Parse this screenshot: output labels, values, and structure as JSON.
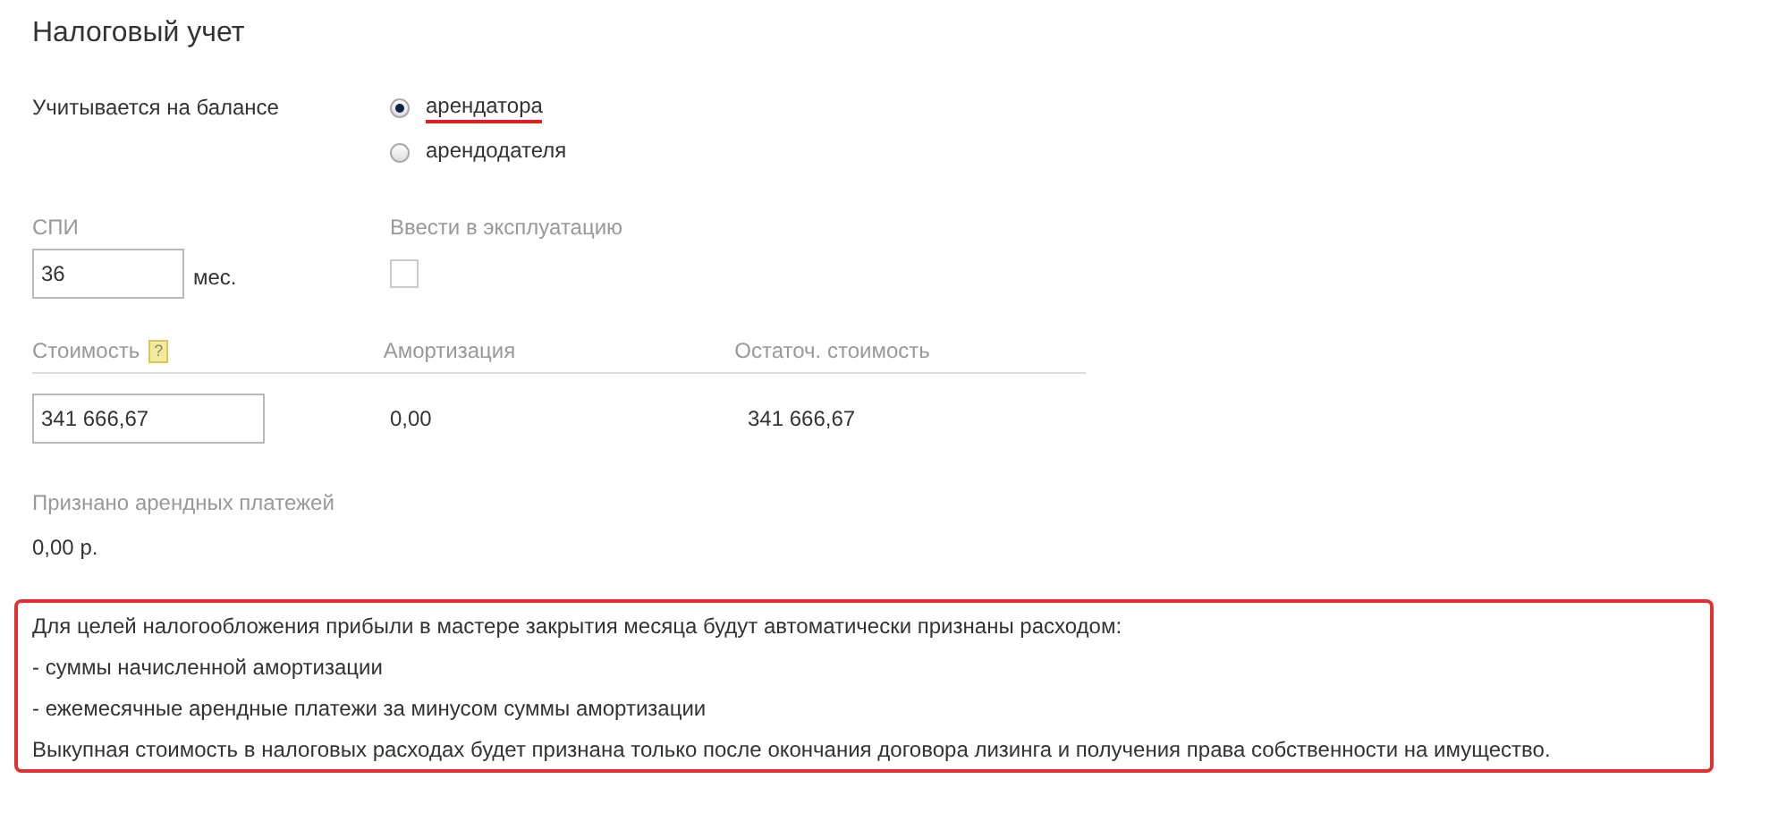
{
  "title": "Налоговый учет",
  "balance": {
    "label": "Учитывается на балансе",
    "options": [
      {
        "label": "арендатора",
        "selected": true,
        "underlined": true
      },
      {
        "label": "арендодателя",
        "selected": false,
        "underlined": false
      }
    ]
  },
  "spi": {
    "label": "СПИ",
    "value": "36",
    "unit": "мес."
  },
  "commission": {
    "label": "Ввести в эксплуатацию",
    "checked": false
  },
  "cost": {
    "columns": [
      {
        "label": "Стоимость",
        "help": "?"
      },
      {
        "label": "Амортизация"
      },
      {
        "label": "Остаточ. стоимость"
      }
    ],
    "input_value": "341 666,67",
    "amortization": "0,00",
    "residual": "341 666,67"
  },
  "payments": {
    "label": "Признано арендных платежей",
    "value": "0,00 р."
  },
  "note": [
    "Для целей налогообложения прибыли в мастере закрытия месяца будут автоматически признаны расходом:",
    "- суммы начисленной амортизации",
    "- ежемесячные арендные платежи за минусом суммы амортизации",
    "Выкупная стоимость в налоговых расходах будет признана только после окончания договора лизинга и получения права собственности на имущество."
  ]
}
